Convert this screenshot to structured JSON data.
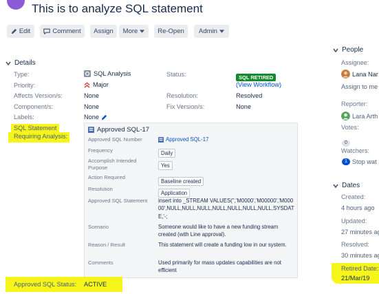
{
  "header": {
    "title": "This is to analyze SQL statement"
  },
  "toolbar": {
    "edit": "Edit",
    "comment": "Comment",
    "assign": "Assign",
    "more": "More",
    "reopen": "Re-Open",
    "admin": "Admin"
  },
  "details": {
    "heading": "Details",
    "type_label": "Type:",
    "type_value": "SQL Analysis",
    "priority_label": "Priority:",
    "priority_value": "Major",
    "affects_label": "Affects Version/s:",
    "affects_value": "None",
    "component_label": "Component/s:",
    "component_value": "None",
    "labels_label": "Labels:",
    "labels_value": "None",
    "status_label": "Status:",
    "status_value": "SQL RETIRED",
    "workflow_link": "(View Workflow)",
    "resolution_label": "Resolution:",
    "resolution_value": "Resolved",
    "fixversion_label": "Fix Version/s:",
    "fixversion_value": "None",
    "sql_statement_label_1": "SQL Statement",
    "sql_statement_label_2": "Requiring Analysis:",
    "approved_status_label": "Approved SQL Status:",
    "approved_status_value": "ACTIVE"
  },
  "panel": {
    "title": "Approved SQL-17",
    "rows": [
      {
        "label": "Approved SQL Number",
        "value": "Approved SQL-17"
      },
      {
        "label": "Frequency",
        "value": "Daily"
      },
      {
        "label": "Accomplish Intended Purpose",
        "value": "Yes"
      },
      {
        "label": "Action Required",
        "value": "Baseline created"
      },
      {
        "label": "Resolution",
        "value": "Application"
      },
      {
        "label": "Approved SQL Statement",
        "value": "insert into _STREAM VALUES('','M0000','M00000','M00000',NULL,NULL,NULL,NULL,NULL,NULL,NULL,SYSDATE,'-;"
      },
      {
        "label": "Scenario",
        "value": "Someone would like to have a new funding stream created (with Line approval)."
      },
      {
        "label": "Reason / Result",
        "value": "This statement will create a funding low in our system."
      },
      {
        "label": "Comments",
        "value": "Used primarily for mass updates capabilities are not efficient"
      }
    ]
  },
  "people": {
    "heading": "People",
    "assignee_label": "Assignee:",
    "assignee_name": "Lana Nar",
    "assign_to_me": "Assign to me",
    "reporter_label": "Reporter:",
    "reporter_name": "Lara Arth",
    "votes_label": "Votes:",
    "votes_count": "0",
    "watchers_label": "Watchers:",
    "watchers_count": "1",
    "watchers_action": "Stop wat"
  },
  "dates": {
    "heading": "Dates",
    "created_label": "Created:",
    "created_value": "4 hours ago",
    "updated_label": "Updated:",
    "updated_value": "27 minutes ag",
    "resolved_label": "Resolved:",
    "resolved_value": "30 minutes ag",
    "retired_label": "Retired Date:",
    "retired_value": "21/Mar/19"
  },
  "colors": {
    "accent": "#0052cc",
    "status_retired": "#14892c",
    "highlight": "#f5f51a",
    "priority_major": "#d04437"
  }
}
